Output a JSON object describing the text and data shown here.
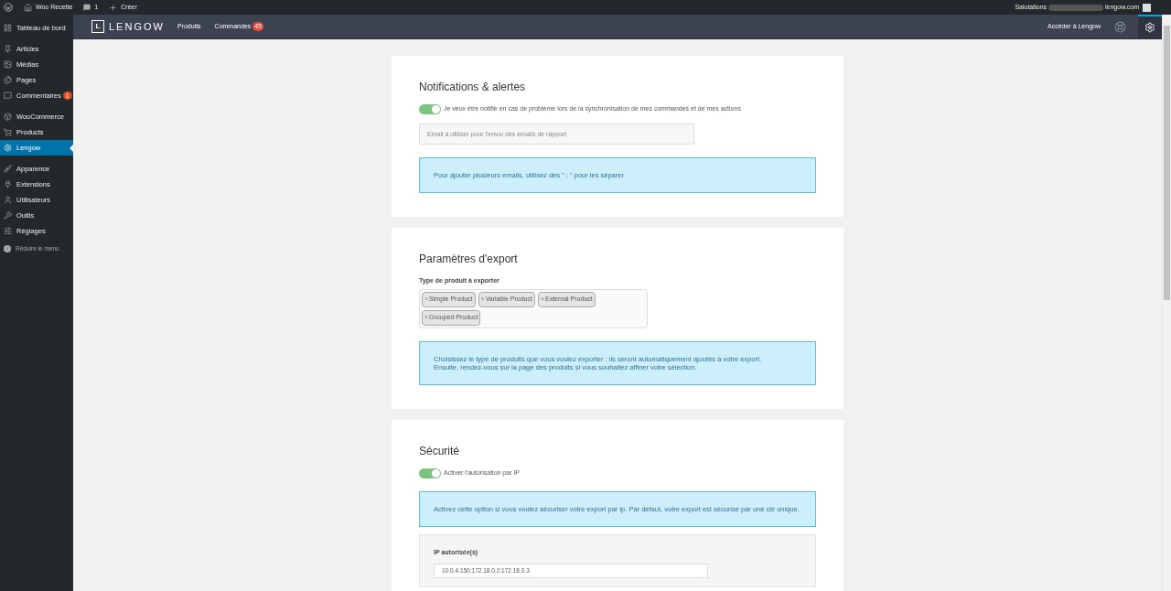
{
  "admin_bar": {
    "site": "Woo Recette",
    "comments": "1",
    "new": "Créer",
    "greeting": "Salutations",
    "account": "lengow.com"
  },
  "sidebar": {
    "groups": [
      [
        {
          "label": "Tableau de bord",
          "selected": false
        }
      ],
      [
        {
          "label": "Articles",
          "selected": false
        },
        {
          "label": "Médias",
          "selected": false
        },
        {
          "label": "Pages",
          "selected": false
        },
        {
          "label": "Commentaires",
          "selected": false,
          "badge": "1"
        }
      ],
      [
        {
          "label": "WooCommerce",
          "selected": false
        },
        {
          "label": "Products",
          "selected": false
        },
        {
          "label": "Lengow",
          "selected": true
        }
      ],
      [
        {
          "label": "Apparence",
          "selected": false
        },
        {
          "label": "Extensions",
          "selected": false
        },
        {
          "label": "Utilisateurs",
          "selected": false
        },
        {
          "label": "Outils",
          "selected": false
        },
        {
          "label": "Réglages",
          "selected": false
        }
      ]
    ],
    "collapse": "Réduire le menu"
  },
  "plugin_header": {
    "logo_letter": "L",
    "logo_text": "LENGOW",
    "nav": [
      {
        "label": "Produits"
      },
      {
        "label": "Commandes",
        "badge": "45"
      }
    ],
    "access": "Accéder à Lengow",
    "settings_selected": true
  },
  "sections": [
    {
      "title": "Notifications & alertes",
      "toggle": {
        "label": "Je veux être notifié en cas de problème lors de la synchronisation de mes commandes et de mes actions",
        "on": true
      },
      "email_field": {
        "placeholder": "Email à utiliser pour l'envoi des emails de rapport"
      },
      "info": "Pour ajouter plusieurs emails, utilisez des \" ; \" pour les séparer"
    },
    {
      "title": "Paramètres d'export",
      "tags_label": "Type de produit à exporter",
      "tags": [
        "Simple Product",
        "Variable Product",
        "External Product",
        "Grouped Product"
      ],
      "tag_remove": "×",
      "info": "Choisissez le type de produits que vous voulez exporter : ils seront automatiquement ajoutés à votre export.\nEnsuite, rendez-vous sur la page des produits si vous souhaitez affiner votre sélection."
    },
    {
      "title": "Sécurité",
      "toggle": {
        "label": "Activer l'autorisation par IP",
        "on": true
      },
      "info": "Activez cette option si vous voulez sécuriser votre export par ip. Par défaut, votre export est sécurisé par une clé unique.",
      "ip": {
        "label": "IP autorisée(s)",
        "value": "10.0.4.150;172.18.0.2;172.18.0.3"
      }
    }
  ]
}
